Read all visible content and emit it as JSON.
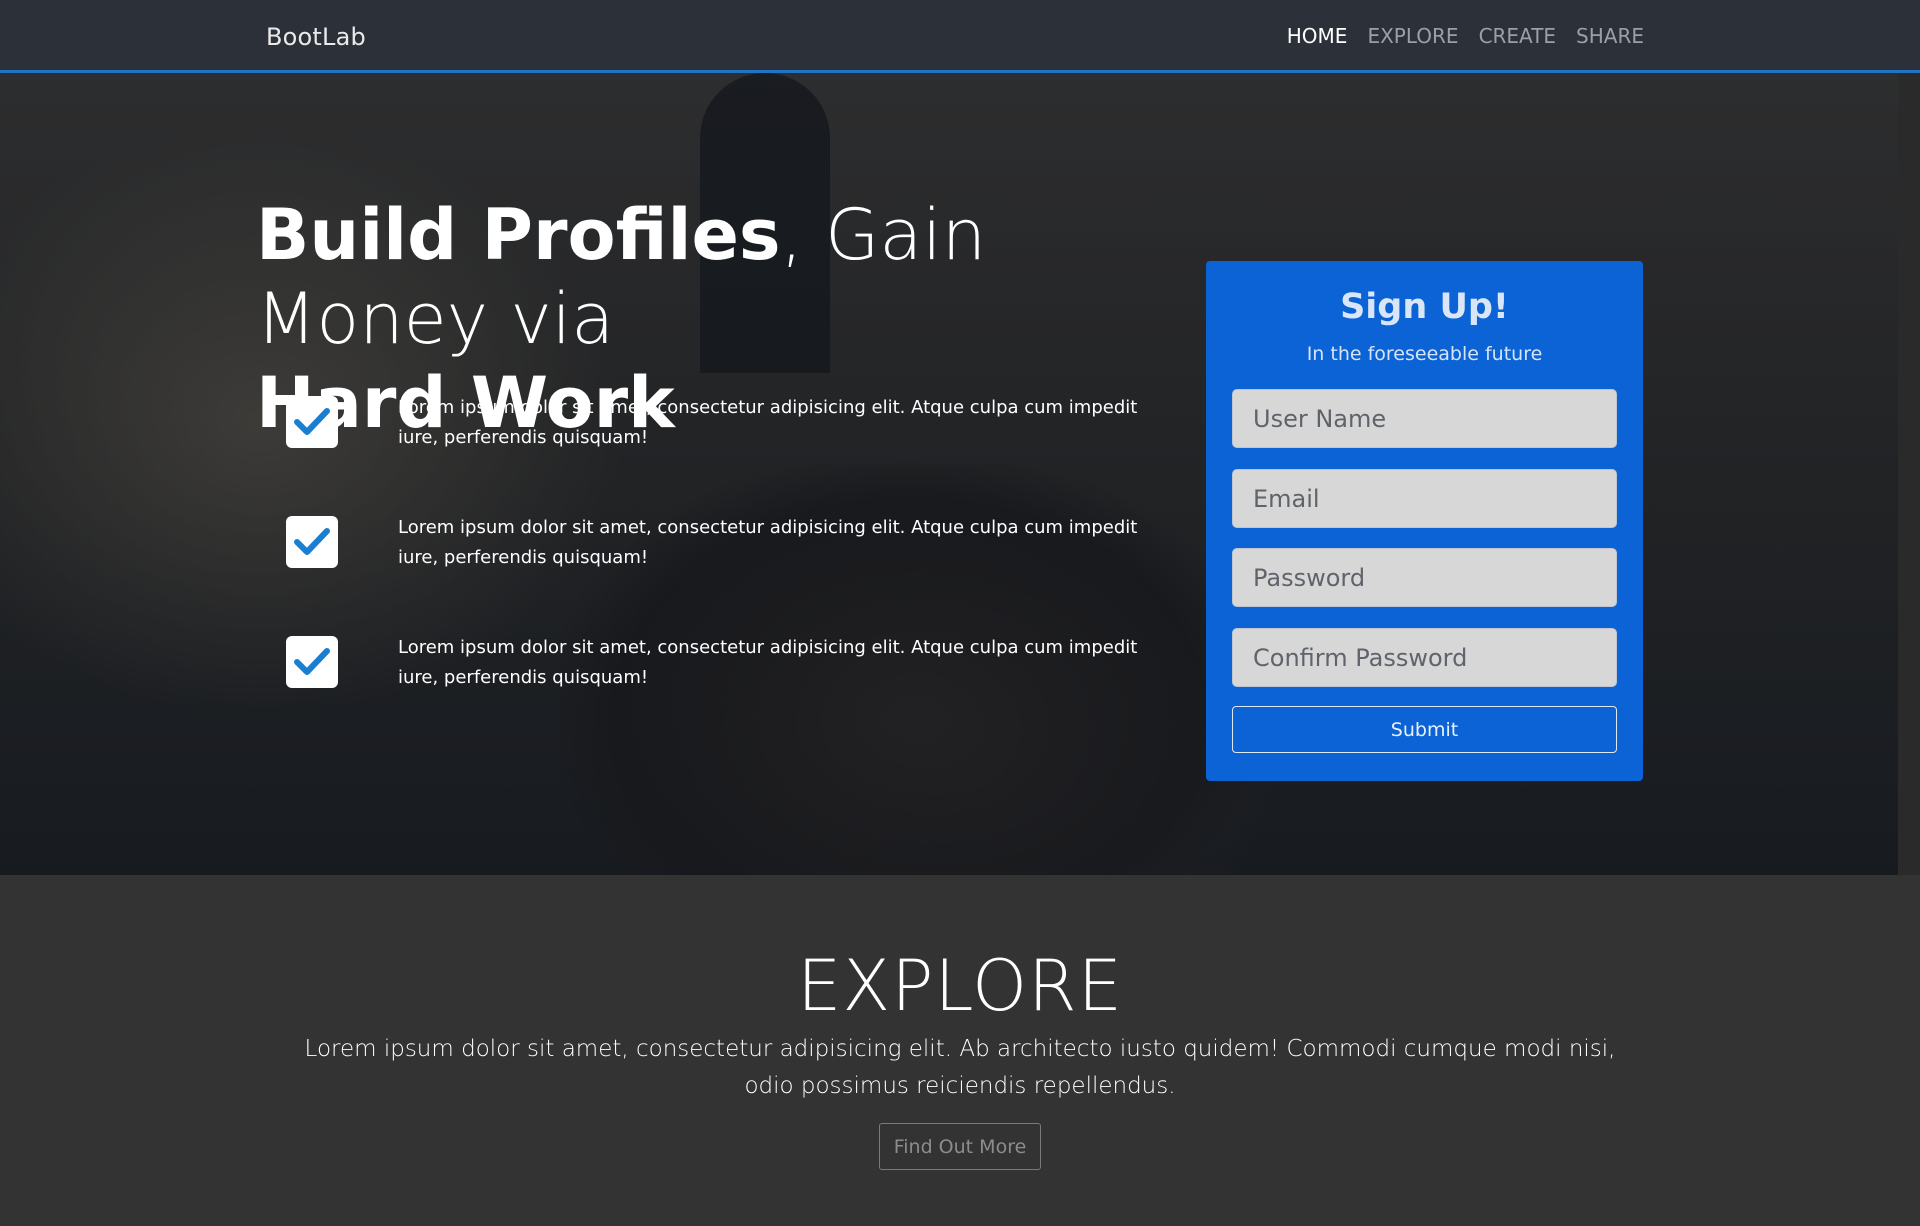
{
  "navbar": {
    "brand": "BootLab",
    "links": [
      "HOME",
      "EXPLORE",
      "CREATE",
      "SHARE"
    ]
  },
  "hero": {
    "title_bold_1": "Build Profiles",
    "title_comma": ",",
    "title_light": " Gain Money via",
    "title_bold_2": "Hard Work",
    "features": [
      {
        "text": "Lorem ipsum dolor sit amet, consectetur adipisicing elit. Atque culpa cum impedit iure, perferendis quisquam!",
        "icon": "check-icon"
      },
      {
        "text": "Lorem ipsum dolor sit amet, consectetur adipisicing elit. Atque culpa cum impedit iure, perferendis quisquam!",
        "icon": "check-icon"
      },
      {
        "text": "Lorem ipsum dolor sit amet, consectetur adipisicing elit. Atque culpa cum impedit iure, perferendis quisquam!",
        "icon": "check-icon"
      }
    ]
  },
  "signup": {
    "title": "Sign Up!",
    "subtitle": "In the foreseeable future",
    "fields": {
      "username_placeholder": "User Name",
      "email_placeholder": "Email",
      "password_placeholder": "Password",
      "confirm_placeholder": "Confirm Password"
    },
    "submit_label": "Submit"
  },
  "explore": {
    "title": "EXPLORE",
    "text": "Lorem ipsum dolor sit amet, consectetur adipisicing elit. Ab architecto iusto quidem! Commodi cumque modi nisi, odio possimus reiciendis repellendus.",
    "button_label": "Find Out More"
  },
  "colors": {
    "accent": "#0b63d6",
    "nav_border": "#1f74c5",
    "check": "#1a7fd1",
    "explore_bg": "#333333"
  }
}
